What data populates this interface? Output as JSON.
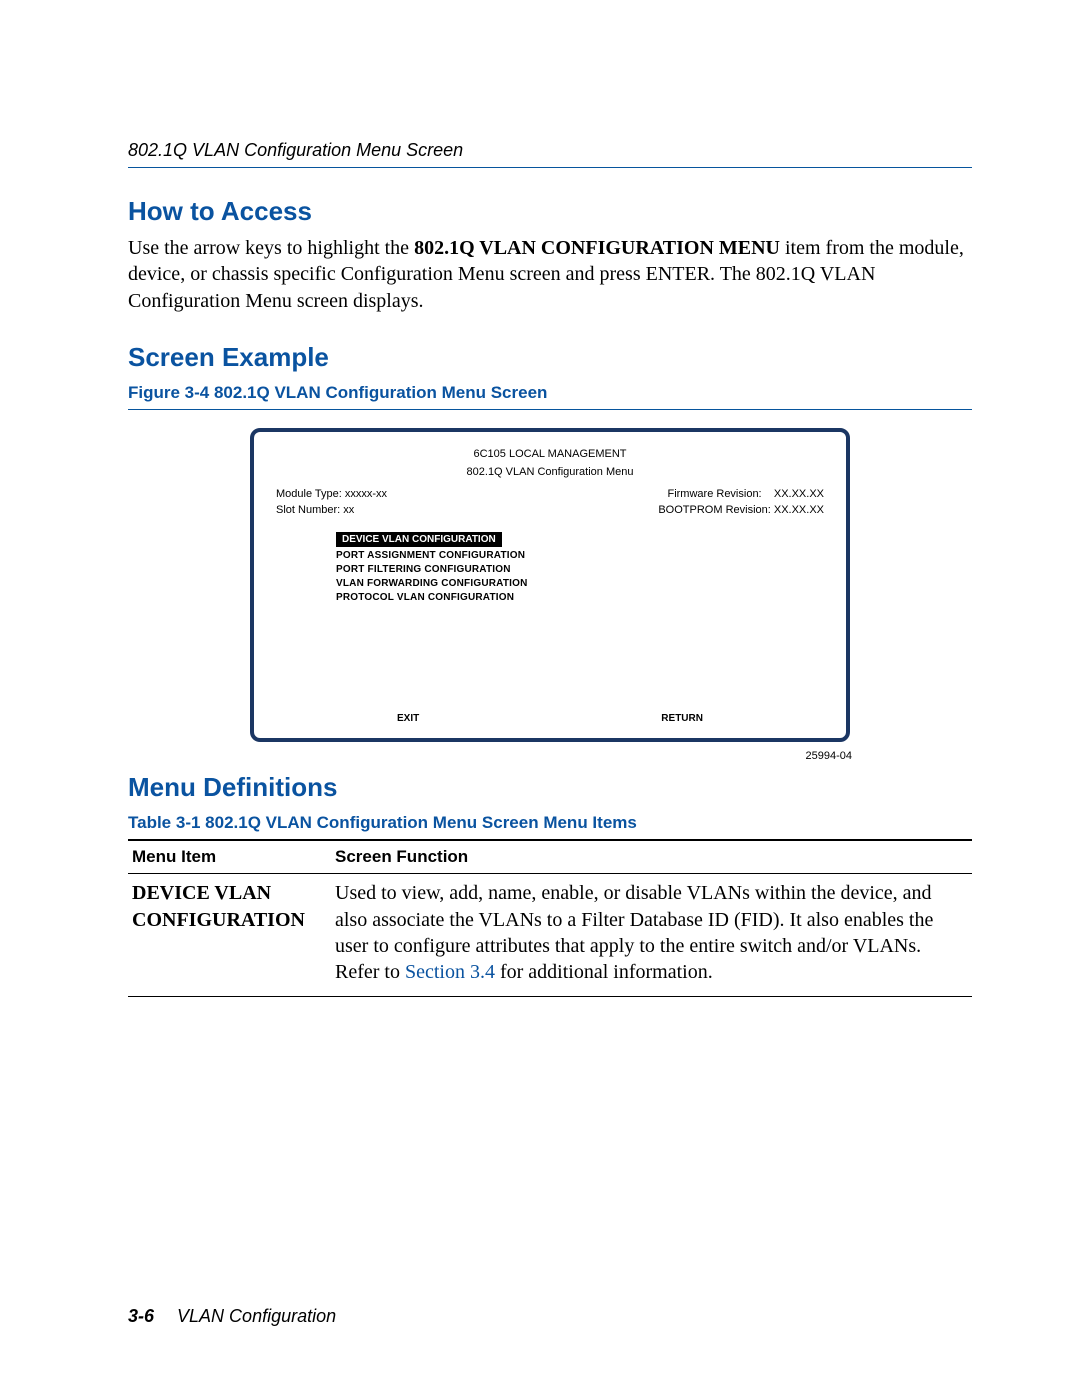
{
  "header": {
    "running_head": "802.1Q VLAN Configuration Menu Screen"
  },
  "sections": {
    "how_to_access": {
      "title": "How to Access",
      "para_pre": "Use the arrow keys to highlight the ",
      "para_bold": "802.1Q VLAN CONFIGURATION MENU",
      "para_post": " item from the module, device, or chassis specific Configuration Menu screen and press ENTER. The 802.1Q VLAN Configuration Menu screen displays."
    },
    "screen_example": {
      "title": "Screen Example",
      "figure_label": "Figure 3-4   802.1Q VLAN Configuration Menu Screen"
    },
    "menu_definitions": {
      "title": "Menu Definitions",
      "table_label": "Table 3-1   802.1Q VLAN Configuration Menu Screen Menu Items",
      "col_item": "Menu Item",
      "col_func": "Screen Function"
    }
  },
  "screen": {
    "title1": "6C105  LOCAL MANAGEMENT",
    "title2": "802.1Q VLAN Configuration Menu",
    "left1": "Module Type: xxxxx-xx",
    "right1a": "Firmware Revision:",
    "right1b": "XX.XX.XX",
    "left2": "Slot Number: xx",
    "right2": "BOOTPROM Revision: XX.XX.XX",
    "menu": [
      "DEVICE VLAN  CONFIGURATION",
      "PORT ASSIGNMENT CONFIGURATION",
      "PORT FILTERING  CONFIGURATION",
      "VLAN FORWARDING CONFIGURATION",
      "PROTOCOL VLAN  CONFIGURATION"
    ],
    "exit": "EXIT",
    "return": "RETURN",
    "fig_id": "25994-04"
  },
  "table_row": {
    "item": "DEVICE VLAN CONFIGURATION",
    "desc_pre": "Used to view, add, name, enable, or disable VLANs within the device, and also associate the VLANs to a Filter Database ID (FID). It also enables the user to configure attributes that apply to the entire switch and/or VLANs. Refer to ",
    "link": "Section 3.4",
    "desc_post": " for additional information."
  },
  "footer": {
    "page_num": "3-6",
    "chapter": "VLAN Configuration"
  }
}
